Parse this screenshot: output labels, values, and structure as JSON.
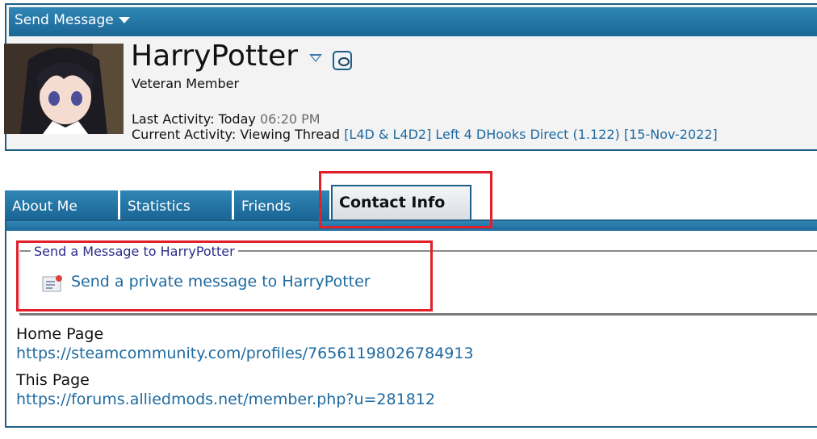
{
  "header": {
    "send_message_label": "Send Message"
  },
  "profile": {
    "username": "HarryPotter",
    "usertitle": "Veteran Member",
    "last_activity_label": "Last Activity:",
    "last_activity_day": "Today",
    "last_activity_time": "06:20 PM",
    "current_activity_label": "Current Activity:",
    "current_activity_value": "Viewing Thread",
    "current_thread_link": "[L4D & L4D2] Left 4 DHooks Direct (1.122) [15-Nov-2022]"
  },
  "tabs": [
    {
      "label": "About Me",
      "active": false
    },
    {
      "label": "Statistics",
      "active": false
    },
    {
      "label": "Friends",
      "active": false
    },
    {
      "label": "Contact Info",
      "active": true
    }
  ],
  "contact": {
    "legend": "Send a Message to HarryPotter",
    "pm_link": "Send a private message to HarryPotter",
    "home_page_label": "Home Page",
    "home_page_url": "https://steamcommunity.com/profiles/76561198026784913",
    "this_page_label": "This Page",
    "this_page_url": "https://forums.alliedmods.net/member.php?u=281812"
  },
  "colors": {
    "accent": "#1b6797",
    "link": "#1e6aa0",
    "highlight": "#e0202a"
  }
}
